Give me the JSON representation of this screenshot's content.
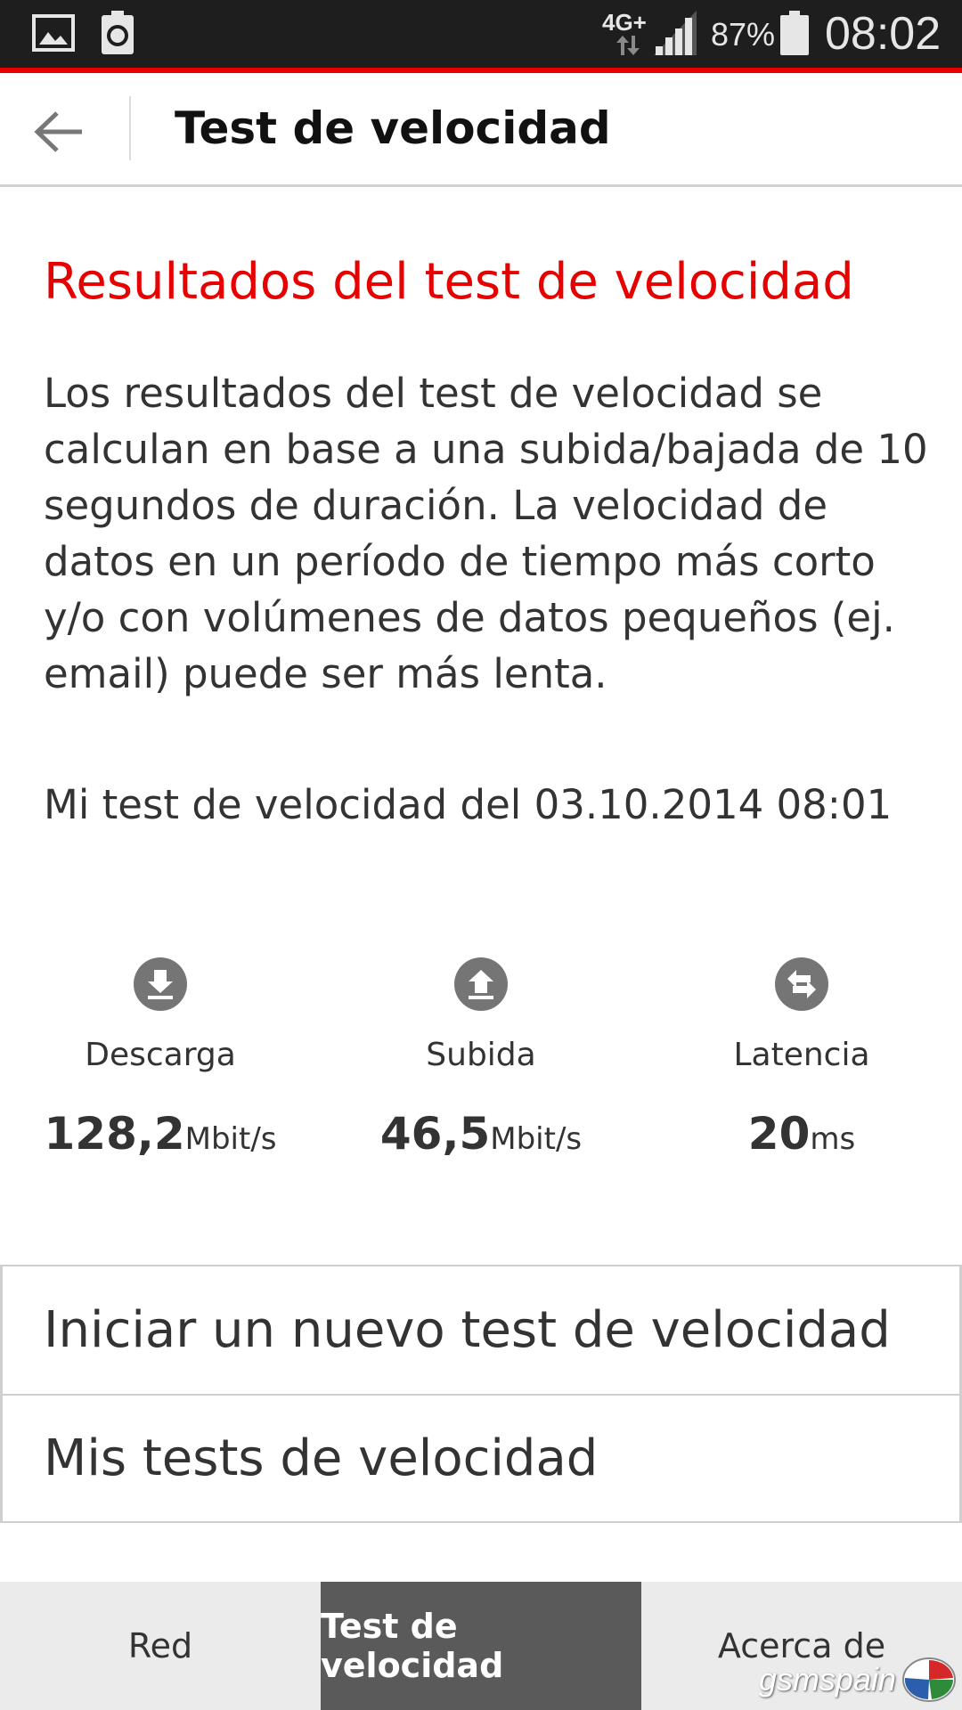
{
  "status_bar": {
    "network": "4G+",
    "battery": "87%",
    "time": "08:02"
  },
  "toolbar": {
    "title": "Test de velocidad"
  },
  "results": {
    "title": "Resultados del test de velocidad",
    "description": "Los resultados del test de velocidad se calculan en base a una subida/bajada de 10 segundos de duración. La velocidad de datos en un período de tiempo más corto y/o con volúmenes de datos pequeños (ej. email) puede ser más lenta.",
    "test_date": "Mi test de velocidad del 03.10.2014 08:01"
  },
  "metrics": [
    {
      "label": "Descarga",
      "value": "128,2",
      "unit": "Mbit/s",
      "icon": "download-icon"
    },
    {
      "label": "Subida",
      "value": "46,5",
      "unit": "Mbit/s",
      "icon": "upload-icon"
    },
    {
      "label": "Latencia",
      "value": "20",
      "unit": "ms",
      "icon": "latency-icon"
    }
  ],
  "actions": {
    "new_test": "Iniciar un nuevo test de velocidad",
    "my_tests": "Mis tests de velocidad"
  },
  "bottom_nav": {
    "tabs": [
      "Red",
      "Test de velocidad",
      "Acerca de"
    ],
    "active_index": 1
  },
  "watermark": {
    "text": "gsmspain"
  },
  "colors": {
    "accent": "#e60000",
    "status_bar": "#1e1e1e",
    "nav_active": "#5a5a5a"
  }
}
